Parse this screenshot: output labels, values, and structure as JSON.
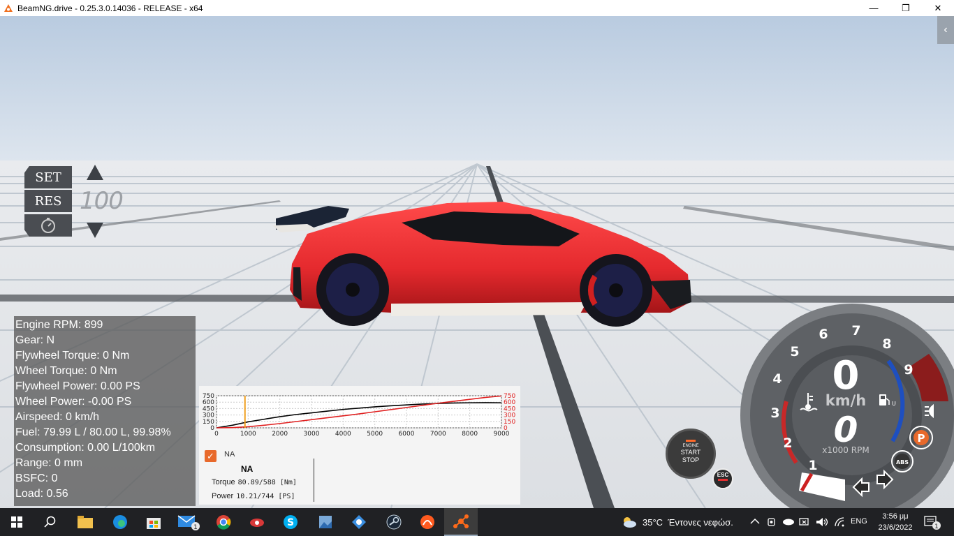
{
  "window": {
    "title": "BeamNG.drive - 0.25.3.0.14036 - RELEASE - x64",
    "minimize": "—",
    "maximize": "❐",
    "close": "✕"
  },
  "hud": {
    "collapse_icon": "‹"
  },
  "cruise_control": {
    "set_label": "SET",
    "res_label": "RES",
    "speed": "100"
  },
  "stats": [
    "Engine RPM: 899",
    "Gear: N",
    "Flywheel Torque: 0 Nm",
    "Wheel Torque: 0 Nm",
    "Flywheel Power: 0.00 PS",
    "Wheel Power: -0.00 PS",
    "Airspeed: 0 km/h",
    "Fuel: 79.99 L / 80.00 L, 99.98%",
    "Consumption: 0.00 L/100km",
    "Range: 0 mm",
    "BSFC: 0",
    "Load: 0.56"
  ],
  "torque_graph": {
    "legend_label": "NA",
    "table_title": "NA",
    "torque_label": "Torque",
    "torque_value": "80.89/588 [Nm]",
    "power_label": "Power",
    "power_value": "10.21/744 [PS]"
  },
  "chart_data": {
    "type": "line",
    "x": [
      0,
      500,
      1000,
      1500,
      2000,
      2500,
      3000,
      3500,
      4000,
      4500,
      5000,
      5500,
      6000,
      6500,
      7000,
      7500,
      8000,
      8500,
      9000
    ],
    "xticks": [
      "0",
      "1000",
      "2000",
      "3000",
      "4000",
      "5000",
      "6000",
      "7000",
      "8000",
      "9000"
    ],
    "xlim": [
      0,
      9000
    ],
    "ylim": [
      0,
      750
    ],
    "yticks_left": [
      "750",
      "600",
      "450",
      "300",
      "150",
      "0"
    ],
    "yticks_right": [
      "750",
      "600",
      "450",
      "300",
      "150",
      "0"
    ],
    "current_rpm": 899,
    "series": [
      {
        "name": "Torque",
        "color": "#000000",
        "values": [
          0,
          60,
          140,
          200,
          260,
          310,
          350,
          390,
          430,
          460,
          490,
          515,
          535,
          555,
          570,
          580,
          585,
          588,
          585
        ]
      },
      {
        "name": "Power",
        "color": "#e02020",
        "values": [
          0,
          5,
          25,
          60,
          100,
          145,
          190,
          235,
          280,
          325,
          375,
          425,
          475,
          525,
          575,
          620,
          665,
          710,
          744
        ]
      }
    ],
    "grid": true
  },
  "engine_button": {
    "line1": "ENGINE",
    "line2": "START",
    "line3": "STOP"
  },
  "esc_button": {
    "label": "ESC"
  },
  "gauge": {
    "ticks": [
      "1",
      "2",
      "3",
      "4",
      "5",
      "6",
      "7",
      "8",
      "9"
    ],
    "speed": "0",
    "speed_unit": "km/h",
    "gear": "0",
    "rpm_unit": "x1000 RPM",
    "rpm_fraction": 0.1,
    "coolant_icon": "coolant-temp-icon",
    "fuel_icon": "fuel-icon",
    "headlight_icon": "headlight-icon",
    "parking_label": "P",
    "abs_label": "ABS",
    "colors": {
      "parking": "#e8692b",
      "redline": "#8b1c1c",
      "cold": "#1e4fc0",
      "hot": "#c82828"
    }
  },
  "taskbar": {
    "weather_temp": "35°C",
    "weather_desc": "Έντονες νεφώσ.",
    "language": "ENG",
    "time": "3:56 μμ",
    "date": "23/6/2022",
    "notification_count": "1",
    "mail_badge": "1"
  }
}
